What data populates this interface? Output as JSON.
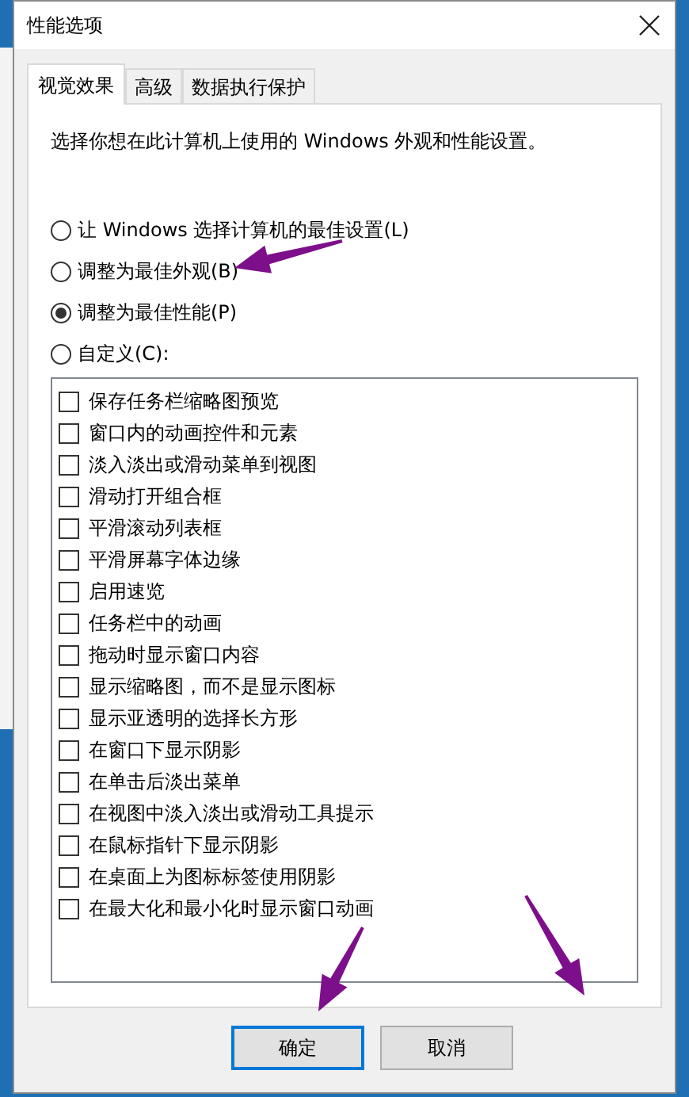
{
  "window": {
    "title": "性能选项"
  },
  "tabs": [
    {
      "label": "视觉效果",
      "selected": true
    },
    {
      "label": "高级",
      "selected": false
    },
    {
      "label": "数据执行保护",
      "selected": false
    }
  ],
  "description": "选择你想在此计算机上使用的 Windows 外观和性能设置。",
  "options": [
    {
      "label": "让 Windows 选择计算机的最佳设置(L)",
      "selected": false
    },
    {
      "label": "调整为最佳外观(B)",
      "selected": false
    },
    {
      "label": "调整为最佳性能(P)",
      "selected": true
    },
    {
      "label": "自定义(C):",
      "selected": false
    }
  ],
  "effects": [
    {
      "label": "保存任务栏缩略图预览",
      "checked": false
    },
    {
      "label": "窗口内的动画控件和元素",
      "checked": false
    },
    {
      "label": "淡入淡出或滑动菜单到视图",
      "checked": false
    },
    {
      "label": "滑动打开组合框",
      "checked": false
    },
    {
      "label": "平滑滚动列表框",
      "checked": false
    },
    {
      "label": "平滑屏幕字体边缘",
      "checked": false
    },
    {
      "label": "启用速览",
      "checked": false
    },
    {
      "label": "任务栏中的动画",
      "checked": false
    },
    {
      "label": "拖动时显示窗口内容",
      "checked": false
    },
    {
      "label": "显示缩略图，而不是显示图标",
      "checked": false
    },
    {
      "label": "显示亚透明的选择长方形",
      "checked": false
    },
    {
      "label": "在窗口下显示阴影",
      "checked": false
    },
    {
      "label": "在单击后淡出菜单",
      "checked": false
    },
    {
      "label": "在视图中淡入淡出或滑动工具提示",
      "checked": false
    },
    {
      "label": "在鼠标指针下显示阴影",
      "checked": false
    },
    {
      "label": "在桌面上为图标标签使用阴影",
      "checked": false
    },
    {
      "label": "在最大化和最小化时显示窗口动画",
      "checked": false
    }
  ],
  "buttons": [
    {
      "label": "确定",
      "default": true
    },
    {
      "label": "取消",
      "default": false
    }
  ]
}
